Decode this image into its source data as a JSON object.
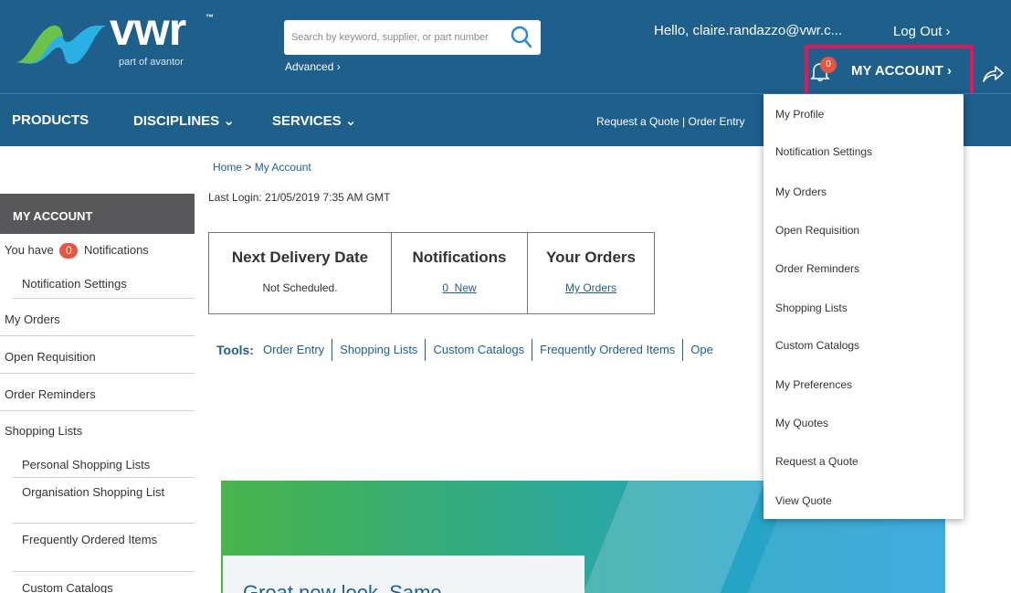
{
  "header": {
    "logo_text": "vwr",
    "logo_tm": "™",
    "logo_sub": "part of avantor",
    "search_placeholder": "Search by keyword, supplier, or part number",
    "advanced_label": "Advanced ›",
    "greeting": "Hello, claire.randazzo@vwr.c...",
    "logout_label": "Log Out ›",
    "notification_count": "0",
    "my_account_label": "MY ACCOUNT ›"
  },
  "nav": {
    "products": "PRODUCTS",
    "disciplines": "DISCIPLINES ⌄",
    "services": "SERVICES ⌄",
    "right_links": "Request a Quote  |  Order Entry"
  },
  "sidebar": {
    "title": "MY ACCOUNT",
    "notif_prefix": "You have",
    "notif_count": "0",
    "notif_suffix": "Notifications",
    "items": [
      {
        "label": "Notification Settings"
      },
      {
        "label": "My Orders"
      },
      {
        "label": "Open Requisition"
      },
      {
        "label": "Order Reminders"
      },
      {
        "label": "Shopping Lists"
      },
      {
        "label": "Personal Shopping Lists"
      },
      {
        "label": "Organisation Shopping List"
      },
      {
        "label": "Frequently Ordered Items"
      },
      {
        "label": "Custom Catalogs"
      }
    ]
  },
  "main": {
    "breadcrumb_home": "Home",
    "breadcrumb_sep": " > ",
    "breadcrumb_current": "My Account",
    "last_login": "Last Login:  21/05/2019 7:35 AM GMT",
    "summary": [
      {
        "title": "Next Delivery Date",
        "value": "Not Scheduled.",
        "link": false
      },
      {
        "title": "Notifications",
        "value": "0  New",
        "link": true
      },
      {
        "title": "Your Orders",
        "value": "My Orders",
        "link": true
      }
    ],
    "tools_label": "Tools:",
    "tools": [
      "Order Entry",
      "Shopping Lists",
      "Custom Catalogs",
      "Frequently Ordered Items",
      "Ope"
    ],
    "banner_text": "Great new look. Same"
  },
  "dropdown": {
    "items": [
      "My Profile",
      "Notification Settings",
      "My Orders",
      "Open Requisition",
      "Order Reminders",
      "Shopping Lists",
      "Custom Catalogs",
      "My Preferences",
      "My Quotes",
      "Request a Quote",
      "View Quote"
    ]
  },
  "colors": {
    "header_blue": "#1e5f8c",
    "badge_orange": "#e8553e",
    "highlight_red": "#e0195c",
    "sidebar_title_gray": "#58585a"
  }
}
